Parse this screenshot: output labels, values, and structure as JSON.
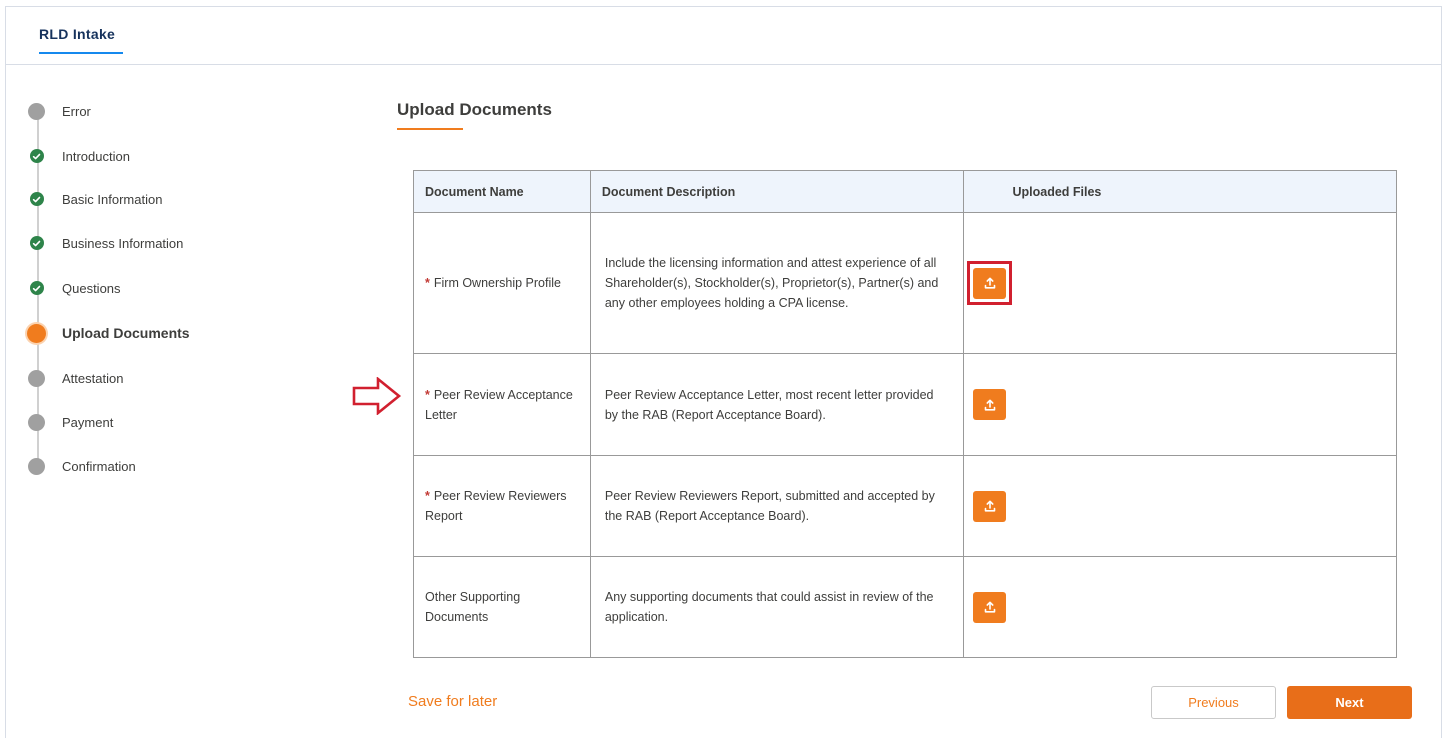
{
  "app": {
    "tab_label": "RLD Intake"
  },
  "steps": [
    {
      "label": "Error",
      "status": "pending"
    },
    {
      "label": "Introduction",
      "status": "done"
    },
    {
      "label": "Basic Information",
      "status": "done"
    },
    {
      "label": "Business Information",
      "status": "done"
    },
    {
      "label": "Questions",
      "status": "done"
    },
    {
      "label": "Upload Documents",
      "status": "current"
    },
    {
      "label": "Attestation",
      "status": "pending"
    },
    {
      "label": "Payment",
      "status": "pending"
    },
    {
      "label": "Confirmation",
      "status": "pending"
    }
  ],
  "main": {
    "title": "Upload Documents",
    "table": {
      "headers": [
        "Document Name",
        "Document Description",
        "Uploaded Files"
      ],
      "rows": [
        {
          "required": true,
          "name": "Firm Ownership Profile",
          "description": "Include the licensing information and attest experience of all Shareholder(s), Stockholder(s), Proprietor(s), Partner(s) and any other employees holding a CPA license.",
          "highlighted": true
        },
        {
          "required": true,
          "name": "Peer Review Acceptance Letter",
          "description": "Peer Review Acceptance Letter, most recent letter provided by the RAB (Report Acceptance Board).",
          "highlighted": false
        },
        {
          "required": true,
          "name": "Peer Review Reviewers Report",
          "description": "Peer Review Reviewers Report, submitted and accepted by the RAB (Report Acceptance Board).",
          "highlighted": false
        },
        {
          "required": false,
          "name": "Other Supporting Documents",
          "description": "Any supporting documents that could assist in review of the application.",
          "highlighted": false
        }
      ]
    }
  },
  "footer": {
    "save_later": "Save for later",
    "previous": "Previous",
    "next": "Next"
  },
  "colors": {
    "accent": "#f07c1e",
    "done": "#2e844a",
    "highlight": "#d1202f",
    "header_bg": "#eef4fc"
  },
  "icons": {
    "upload": "upload-icon",
    "check": "check-icon",
    "arrow": "right-arrow-outline-icon"
  }
}
